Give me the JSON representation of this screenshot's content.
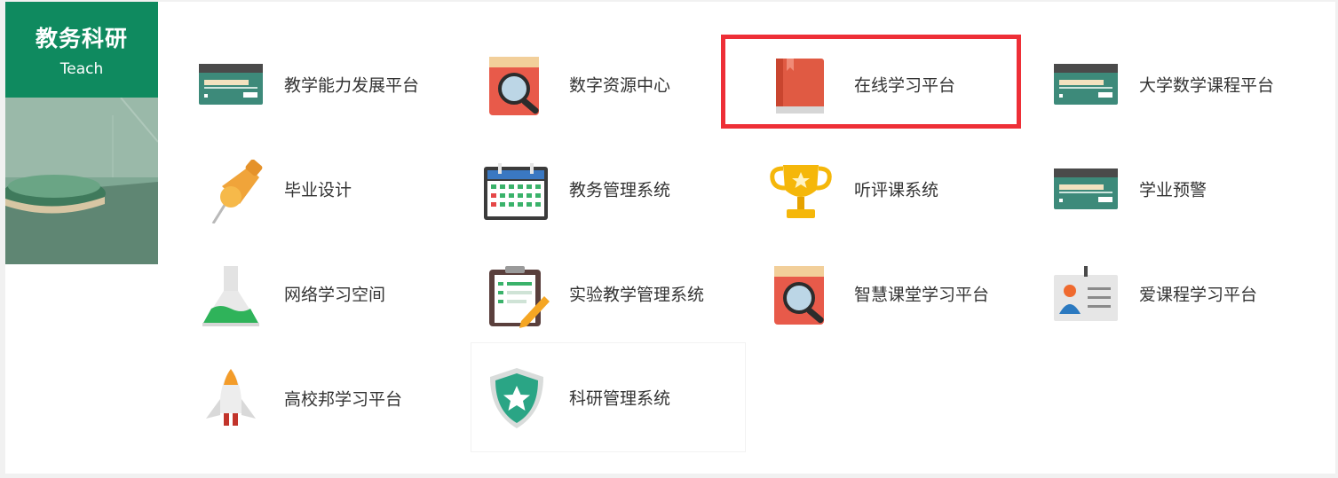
{
  "side": {
    "title": "教务科研",
    "subtitle": "Teach"
  },
  "items": [
    {
      "label": "教学能力发展平台",
      "icon": "card-icon"
    },
    {
      "label": "数字资源中心",
      "icon": "book-search-icon"
    },
    {
      "label": "在线学习平台",
      "icon": "red-book-icon"
    },
    {
      "label": "大学数学课程平台",
      "icon": "card-icon"
    },
    {
      "label": "毕业设计",
      "icon": "pushpin-icon"
    },
    {
      "label": "教务管理系统",
      "icon": "calendar-icon"
    },
    {
      "label": "听评课系统",
      "icon": "trophy-icon"
    },
    {
      "label": "学业预警",
      "icon": "card-icon"
    },
    {
      "label": "网络学习空间",
      "icon": "flask-icon"
    },
    {
      "label": "实验教学管理系统",
      "icon": "clipboard-icon"
    },
    {
      "label": "智慧课堂学习平台",
      "icon": "book-search-icon"
    },
    {
      "label": "爱课程学习平台",
      "icon": "id-card-icon"
    },
    {
      "label": "高校邦学习平台",
      "icon": "rocket-icon"
    },
    {
      "label": "科研管理系统",
      "icon": "shield-star-icon"
    }
  ],
  "colors": {
    "side_header": "#0f8a5f",
    "highlight": "#ee2f37"
  }
}
